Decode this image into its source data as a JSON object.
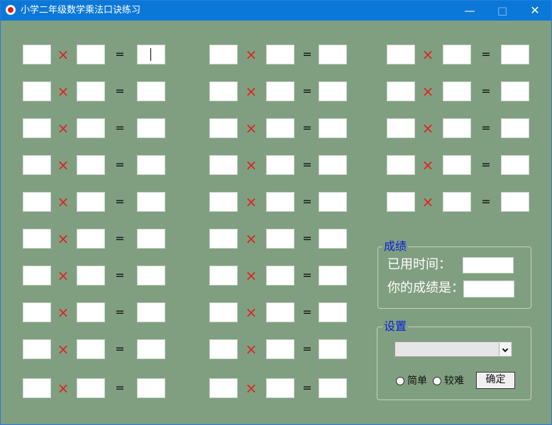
{
  "window": {
    "title": "小学二年级数学乘法口诀练习",
    "controls": {
      "minimize": "—",
      "maximize": "□",
      "close": "✕"
    }
  },
  "quiz": {
    "times_symbol": "×",
    "equals_symbol": "="
  },
  "score_group": {
    "title": "成绩",
    "elapsed_label": "已用时间：",
    "elapsed_value": "",
    "score_label": "你的成绩是：",
    "score_value": ""
  },
  "settings_group": {
    "title": "设置",
    "selected_option": "",
    "radio_easy": "简单",
    "radio_hard": "较难",
    "confirm_button": "确定"
  },
  "icons": {
    "app": "app-logo-icon",
    "dropdown": "chevron-down-icon"
  },
  "colors": {
    "titlebar": "#0b78d7",
    "background": "#809f80",
    "times": "#df2020",
    "group_title": "#0a20dd"
  }
}
